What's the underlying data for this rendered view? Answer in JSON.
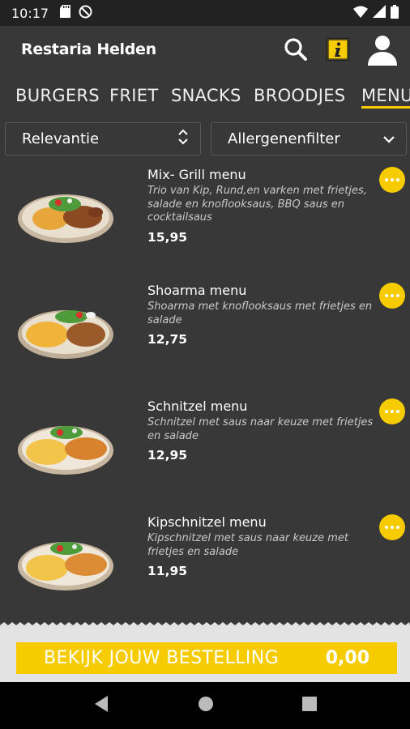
{
  "status_bar": {
    "time": "10:17"
  },
  "app_bar": {
    "title": "Restaria Helden"
  },
  "tabs": [
    {
      "label": "BURGERS"
    },
    {
      "label": "FRIET"
    },
    {
      "label": "SNACKS"
    },
    {
      "label": "BROODJES"
    },
    {
      "label": "MENU"
    }
  ],
  "filters": {
    "sort": {
      "value": "Relevantie"
    },
    "allergen": {
      "value": "Allergenenfilter"
    }
  },
  "items": [
    {
      "name": "Mix- Grill menu",
      "description": "Trio van Kip, Rund,en varken met frietjes, salade en knoflooksaus, BBQ saus en cocktailsaus",
      "price": "15,95"
    },
    {
      "name": "Shoarma menu",
      "description": "Shoarma met knoflooksaus met frietjes en salade",
      "price": "12,75"
    },
    {
      "name": "Schnitzel menu",
      "description": "Schnitzel met saus naar keuze met frietjes en salade",
      "price": "12,95"
    },
    {
      "name": "Kipschnitzel menu",
      "description": "Kipschnitzel met saus naar keuze met frietjes en salade",
      "price": "11,95"
    }
  ],
  "order": {
    "label": "BEKIJK JOUW BESTELLING",
    "total": "0,00"
  },
  "colors": {
    "accent": "#f6cc00",
    "background": "#383838"
  },
  "icons": [
    "sd-card-icon",
    "do-not-disturb-icon",
    "wifi-icon",
    "signal-icon",
    "battery-icon",
    "search-icon",
    "info-icon",
    "user-icon",
    "more-icon",
    "back-icon",
    "home-icon",
    "recents-icon"
  ]
}
